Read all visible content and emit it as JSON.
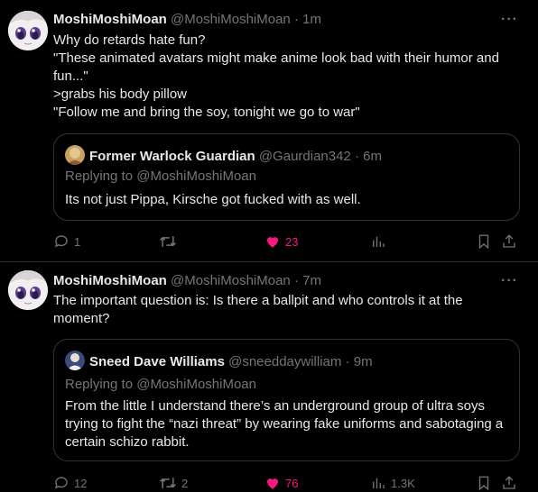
{
  "tweets": [
    {
      "author_name": "MoshiMoshiMoan",
      "handle": "@MoshiMoshiMoan",
      "time": "1m",
      "more_label": "···",
      "body_lines": [
        "Why do retards hate fun?",
        "\"These animated avatars might make anime look bad with their humor and fun...\"",
        ">grabs his body pillow",
        "\"Follow me and bring the soy, tonight we go to war\""
      ],
      "quote": {
        "author_name": "Former Warlock Guardian",
        "handle": "@Gaurdian342",
        "time": "6m",
        "replying_to": "Replying to @MoshiMoshiMoan",
        "text": "Its not just Pippa, Kirsche got fucked with as well."
      },
      "actions": {
        "replies": "1",
        "retweets": "",
        "likes": "23",
        "views": ""
      }
    },
    {
      "author_name": "MoshiMoshiMoan",
      "handle": "@MoshiMoshiMoan",
      "time": "7m",
      "more_label": "···",
      "body_lines": [
        "The important question is: Is there a ballpit and who controls it at the moment?"
      ],
      "quote": {
        "author_name": "Sneed Dave Williams",
        "handle": "@sneeddaywilliam",
        "time": "9m",
        "replying_to": "Replying to @MoshiMoshiMoan",
        "text": "From the little I understand there’s an underground group of ultra soys trying to fight the “nazi threat” by wearing fake uniforms and sabotaging a certain schizo rabbit."
      },
      "actions": {
        "replies": "12",
        "retweets": "2",
        "likes": "76",
        "views": "1.3K"
      }
    }
  ],
  "colors": {
    "background": "#000000",
    "text": "#e7e9ea",
    "muted": "#71767b",
    "like": "#f91880",
    "border": "#2f3336"
  },
  "icons": [
    "reply-icon",
    "retweet-icon",
    "heart-icon",
    "views-icon",
    "bookmark-icon",
    "share-icon",
    "more-icon"
  ]
}
